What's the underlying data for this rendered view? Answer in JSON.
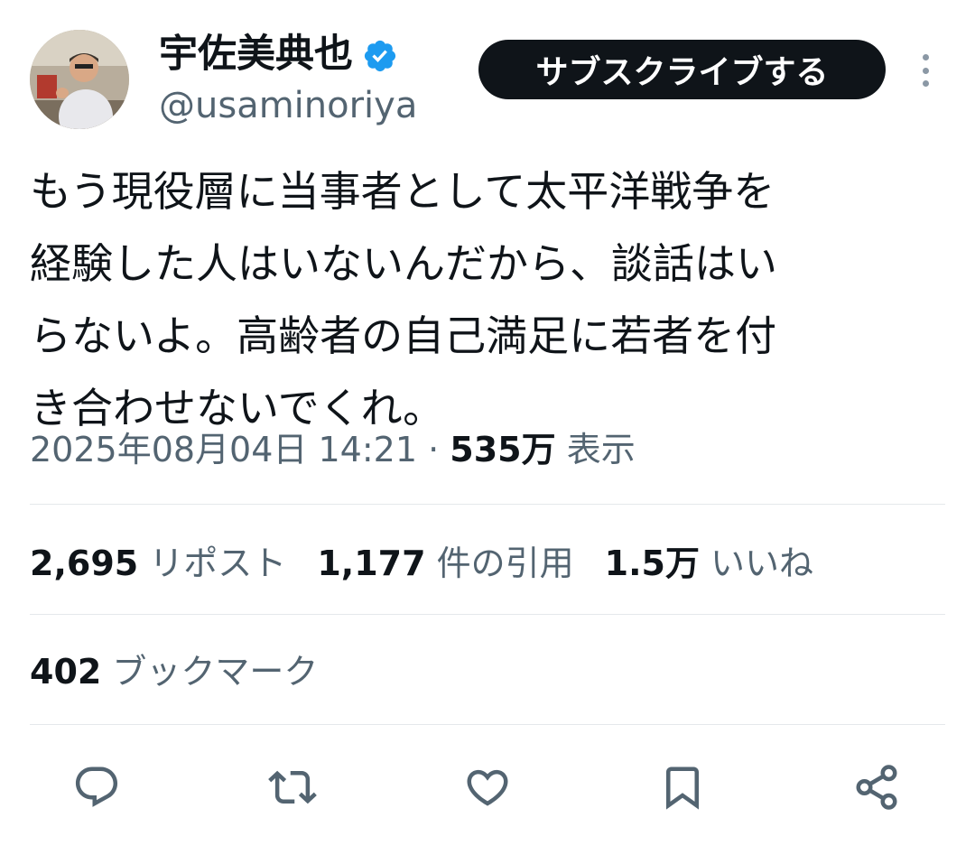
{
  "author": {
    "display_name": "宇佐美典也",
    "handle": "@usaminoriya",
    "verified_icon": "verified-badge-icon",
    "verified_color": "#1d9bf0"
  },
  "subscribe_label": "サブスクライブする",
  "more_icon": "more-vertical-icon",
  "tweet": {
    "text": "もう現役層に当事者として太平洋戦争を\n経験した人はいないんだから、談話はい\nらないよ。高齢者の自己満足に若者を付\nき合わせないでくれ。",
    "timestamp": "2025年08月04日 14:21",
    "separator": "·",
    "views_count": "535万",
    "views_label": "表示"
  },
  "stats": {
    "reposts": {
      "count": "2,695",
      "label": "リポスト"
    },
    "quotes": {
      "count": "1,177",
      "label": "件の引用"
    },
    "likes": {
      "count": "1.5万",
      "label": "いいね"
    },
    "bookmarks": {
      "count": "402",
      "label": "ブックマーク"
    }
  },
  "actions": [
    "reply-icon",
    "repost-icon",
    "like-icon",
    "bookmark-icon",
    "share-icon"
  ],
  "colors": {
    "text_primary": "#0f1419",
    "text_secondary": "#536471",
    "divider": "#e5e8eb",
    "button_bg": "#0f1419",
    "icon": "#536471"
  }
}
